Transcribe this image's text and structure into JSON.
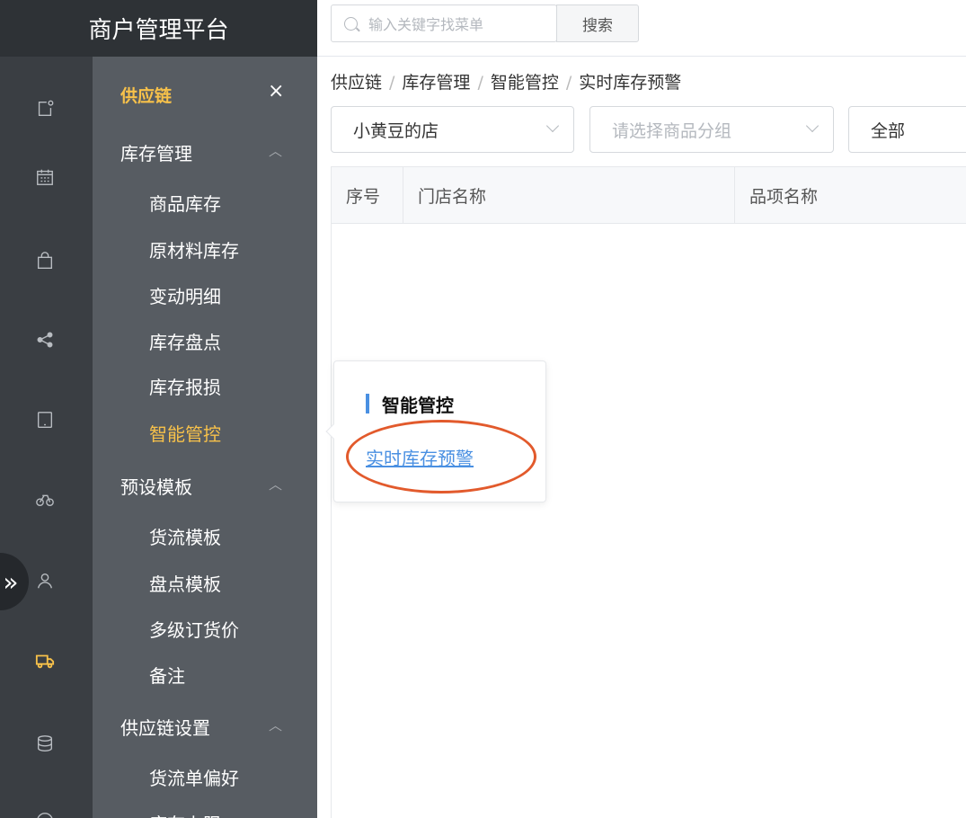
{
  "app": {
    "title": "商户管理平台"
  },
  "search": {
    "placeholder": "输入关键字找菜单",
    "button_label": "搜索"
  },
  "rail": {
    "collapse_label": "»"
  },
  "submenu": {
    "title": "供应链",
    "close_label": "×",
    "groups": [
      {
        "label": "库存管理",
        "caret": "︿",
        "items": [
          "商品库存",
          "原材料库存",
          "变动明细",
          "库存盘点",
          "库存报损",
          "智能管控"
        ]
      },
      {
        "label": "预设模板",
        "caret": "︿",
        "items": [
          "货流模板",
          "盘点模板",
          "多级订货价",
          "备注"
        ]
      },
      {
        "label": "供应链设置",
        "caret": "︿",
        "items": [
          "货流单偏好",
          "库存上限"
        ]
      }
    ],
    "active_item": "智能管控"
  },
  "breadcrumb": [
    "供应链",
    "库存管理",
    "智能管控",
    "实时库存预警"
  ],
  "filters": {
    "store": "小黄豆的店",
    "group_placeholder": "请选择商品分组",
    "status": "全部"
  },
  "table": {
    "columns": [
      "序号",
      "门店名称",
      "品项名称"
    ]
  },
  "popover": {
    "title": "智能管控",
    "link": "实时库存预警"
  },
  "colors": {
    "accent": "#f7c14a",
    "link": "#4a90e2",
    "highlight": "#e25a2c"
  }
}
